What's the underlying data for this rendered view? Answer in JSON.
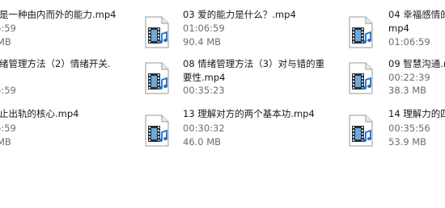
{
  "files": [
    {
      "lines": [
        "是一种由内而外的能力.mp4"
      ],
      "duration": "6:59",
      "size": "MB"
    },
    {
      "lines": [
        "03 爱的能力是什么？.mp4"
      ],
      "duration": "01:06:59",
      "size": "90.4 MB"
    },
    {
      "lines": [
        "04 幸福感情的",
        "mp4"
      ],
      "duration": "01:06:59",
      "size": ""
    },
    {
      "lines": [
        "绪管理方法（2）情绪开关."
      ],
      "duration": "6:59",
      "size": ""
    },
    {
      "lines": [
        "08 情绪管理方法（3）对与错的重",
        "要性.mp4"
      ],
      "duration": "00:35:23",
      "size": ""
    },
    {
      "lines": [
        "09 智慧沟通.m"
      ],
      "duration": "00:22:39",
      "size": "38.3 MB"
    },
    {
      "lines": [
        "止出轨的核心.mp4"
      ],
      "duration": "6:59",
      "size": "MB"
    },
    {
      "lines": [
        "13 理解对方的两个基本功.mp4"
      ],
      "duration": "00:30:32",
      "size": "46.0 MB"
    },
    {
      "lines": [
        "14 理解力的四"
      ],
      "duration": "00:35:56",
      "size": "53.9 MB"
    }
  ]
}
